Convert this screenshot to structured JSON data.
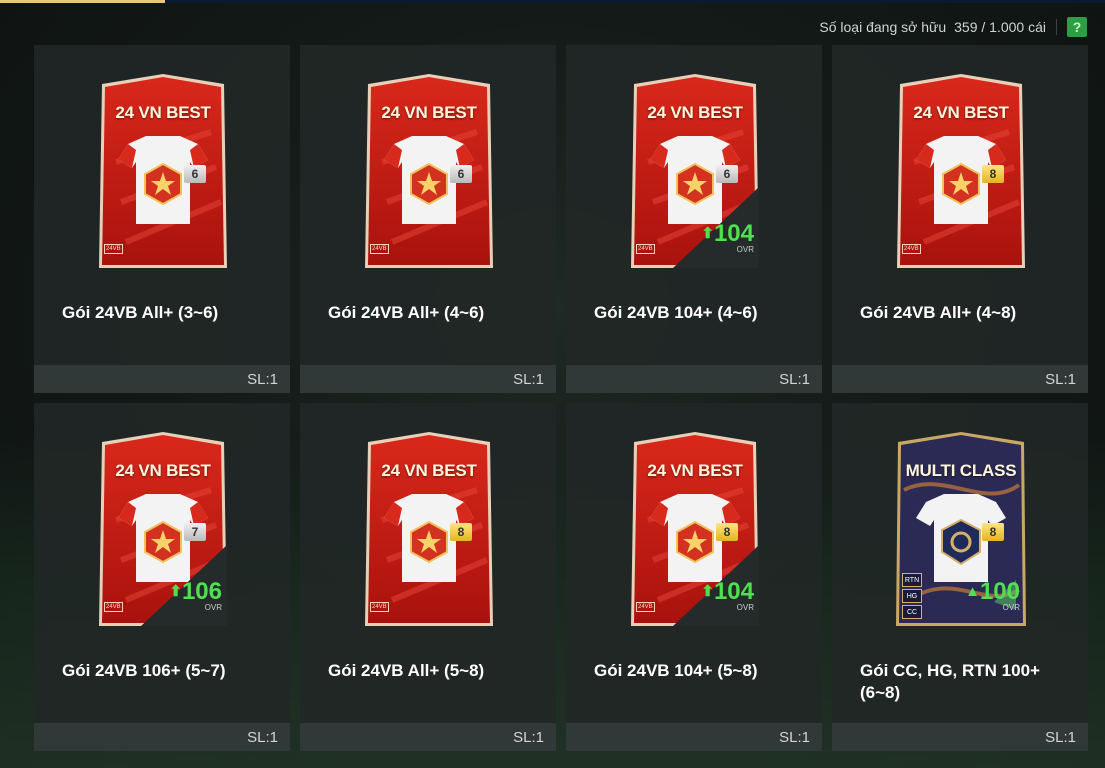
{
  "header": {
    "owned_label": "Số loại đang sở hữu",
    "owned_count": "359 / 1.000 cái",
    "help_icon": "question-icon",
    "help_label": "?"
  },
  "colors": {
    "tile_bg": "#212726",
    "pack_red": "#c41a12",
    "ovr_green": "#4fe04f",
    "help_green": "#2e9e44"
  },
  "packs": [
    {
      "card_title": "24 VN BEST",
      "tier": "6",
      "tier_color": "silver",
      "logo": "24VB",
      "ovr": "",
      "ovr_label": "",
      "name": "Gói 24VB All+ (3~6)",
      "qty": "SL:1"
    },
    {
      "card_title": "24 VN BEST",
      "tier": "6",
      "tier_color": "silver",
      "logo": "24VB",
      "ovr": "",
      "ovr_label": "",
      "name": "Gói 24VB All+ (4~6)",
      "qty": "SL:1"
    },
    {
      "card_title": "24 VN BEST",
      "tier": "6",
      "tier_color": "silver",
      "logo": "24VB",
      "ovr": "104",
      "ovr_label": "OVR",
      "name": "Gói 24VB 104+ (4~6)",
      "qty": "SL:1"
    },
    {
      "card_title": "24 VN BEST",
      "tier": "8",
      "tier_color": "gold",
      "logo": "24VB",
      "ovr": "",
      "ovr_label": "",
      "name": "Gói 24VB All+ (4~8)",
      "qty": "SL:1"
    },
    {
      "card_title": "24 VN BEST",
      "tier": "7",
      "tier_color": "silver",
      "logo": "24VB",
      "ovr": "106",
      "ovr_label": "OVR",
      "name": "Gói 24VB 106+ (5~7)",
      "qty": "SL:1"
    },
    {
      "card_title": "24 VN BEST",
      "tier": "8",
      "tier_color": "gold",
      "logo": "24VB",
      "ovr": "",
      "ovr_label": "",
      "name": "Gói 24VB All+ (5~8)",
      "qty": "SL:1"
    },
    {
      "card_title": "24 VN BEST",
      "tier": "8",
      "tier_color": "gold",
      "logo": "24VB",
      "ovr": "104",
      "ovr_label": "OVR",
      "name": "Gói 24VB 104+ (5~8)",
      "qty": "SL:1"
    },
    {
      "card_title": "MULTI CLASS",
      "tier": "8",
      "tier_color": "gold",
      "badges": [
        "RTN",
        "HG",
        "CC"
      ],
      "ovr": "100",
      "ovr_label": "OVR",
      "name": "Gói CC, HG, RTN 100+ (6~8)",
      "qty": "SL:1"
    }
  ]
}
